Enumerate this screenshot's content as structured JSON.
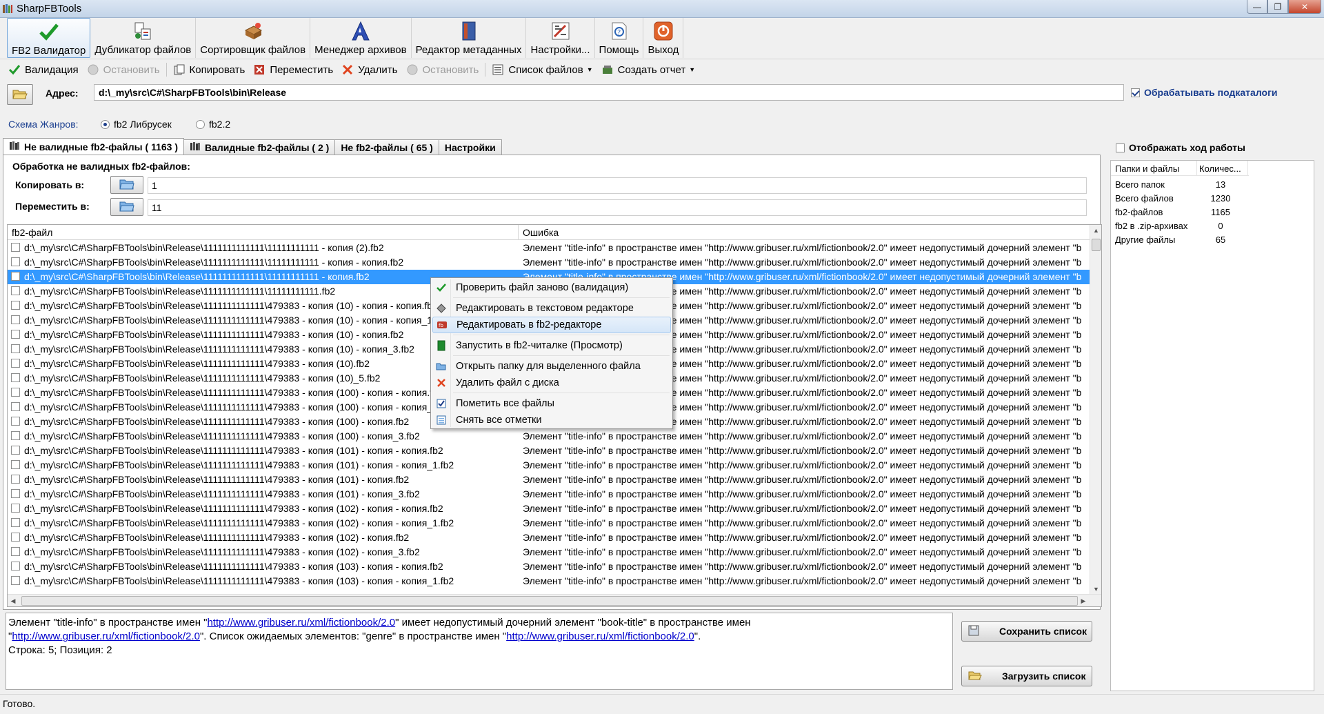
{
  "window": {
    "title": "SharpFBTools",
    "min": "—",
    "max": "❐",
    "close": "✕"
  },
  "big_toolbar": [
    {
      "label": "FB2 Валидатор",
      "icon": "checkmark-icon",
      "active": true
    },
    {
      "label": "Дубликатор файлов",
      "icon": "duplicator-icon"
    },
    {
      "label": "Сортировщик файлов",
      "icon": "sorter-icon"
    },
    {
      "label": "Менеджер архивов",
      "icon": "archive-manager-icon"
    },
    {
      "label": "Редактор метаданных",
      "icon": "metadata-editor-icon"
    },
    {
      "label": "Настройки...",
      "icon": "settings-icon"
    },
    {
      "label": "Помощь",
      "icon": "help-icon"
    },
    {
      "label": "Выход",
      "icon": "exit-icon"
    }
  ],
  "small_toolbar": {
    "validate": "Валидация",
    "stop1": "Остановить",
    "copy": "Копировать",
    "move": "Переместить",
    "delete": "Удалить",
    "stop2": "Остановить",
    "file_list": "Список файлов",
    "report": "Создать отчет"
  },
  "address": {
    "label": "Адрес:",
    "value": "d:\\_my\\src\\C#\\SharpFBTools\\bin\\Release",
    "subdirs_label": "Обрабатывать подкаталоги"
  },
  "genre": {
    "label": "Схема Жанров:",
    "opt1": "fb2 Либрусек",
    "opt2": "fb2.2"
  },
  "tabs": {
    "invalid": "Не валидные fb2-файлы ( 1163 )",
    "valid": "Валидные fb2-файлы ( 2 )",
    "not_fb2": "Не fb2-файлы ( 65 )",
    "settings": "Настройки"
  },
  "processing": {
    "title": "Обработка не валидных fb2-файлов:",
    "copy_label": "Копировать в:",
    "copy_value": "1",
    "move_label": "Переместить в:",
    "move_value": "11"
  },
  "grid": {
    "col1": "fb2-файл",
    "col2": "Ошибка",
    "error_text": "Элемент \"title-info\" в пространстве имен \"http://www.gribuser.ru/xml/fictionbook/2.0\" имеет недопустимый дочерний элемент \"b",
    "rows": [
      "d:\\_my\\src\\C#\\SharpFBTools\\bin\\Release\\1111111111111\\11111111111 - копия (2).fb2",
      "d:\\_my\\src\\C#\\SharpFBTools\\bin\\Release\\1111111111111\\11111111111 - копия - копия.fb2",
      "d:\\_my\\src\\C#\\SharpFBTools\\bin\\Release\\1111111111111\\11111111111 - копия.fb2",
      "d:\\_my\\src\\C#\\SharpFBTools\\bin\\Release\\1111111111111\\11111111111.fb2",
      "d:\\_my\\src\\C#\\SharpFBTools\\bin\\Release\\1111111111111\\479383 - копия (10) - копия - копия.fb2",
      "d:\\_my\\src\\C#\\SharpFBTools\\bin\\Release\\1111111111111\\479383 - копия (10) - копия - копия_1.fb2",
      "d:\\_my\\src\\C#\\SharpFBTools\\bin\\Release\\1111111111111\\479383 - копия (10) - копия.fb2",
      "d:\\_my\\src\\C#\\SharpFBTools\\bin\\Release\\1111111111111\\479383 - копия (10) - копия_3.fb2",
      "d:\\_my\\src\\C#\\SharpFBTools\\bin\\Release\\1111111111111\\479383 - копия (10).fb2",
      "d:\\_my\\src\\C#\\SharpFBTools\\bin\\Release\\1111111111111\\479383 - копия (10)_5.fb2",
      "d:\\_my\\src\\C#\\SharpFBTools\\bin\\Release\\1111111111111\\479383 - копия (100) - копия - копия.fb2",
      "d:\\_my\\src\\C#\\SharpFBTools\\bin\\Release\\1111111111111\\479383 - копия (100) - копия - копия_1.fb2",
      "d:\\_my\\src\\C#\\SharpFBTools\\bin\\Release\\1111111111111\\479383 - копия (100) - копия.fb2",
      "d:\\_my\\src\\C#\\SharpFBTools\\bin\\Release\\1111111111111\\479383 - копия (100) - копия_3.fb2",
      "d:\\_my\\src\\C#\\SharpFBTools\\bin\\Release\\1111111111111\\479383 - копия (101) - копия - копия.fb2",
      "d:\\_my\\src\\C#\\SharpFBTools\\bin\\Release\\1111111111111\\479383 - копия (101) - копия - копия_1.fb2",
      "d:\\_my\\src\\C#\\SharpFBTools\\bin\\Release\\1111111111111\\479383 - копия (101) - копия.fb2",
      "d:\\_my\\src\\C#\\SharpFBTools\\bin\\Release\\1111111111111\\479383 - копия (101) - копия_3.fb2",
      "d:\\_my\\src\\C#\\SharpFBTools\\bin\\Release\\1111111111111\\479383 - копия (102) - копия - копия.fb2",
      "d:\\_my\\src\\C#\\SharpFBTools\\bin\\Release\\1111111111111\\479383 - копия (102) - копия - копия_1.fb2",
      "d:\\_my\\src\\C#\\SharpFBTools\\bin\\Release\\1111111111111\\479383 - копия (102) - копия.fb2",
      "d:\\_my\\src\\C#\\SharpFBTools\\bin\\Release\\1111111111111\\479383 - копия (102) - копия_3.fb2",
      "d:\\_my\\src\\C#\\SharpFBTools\\bin\\Release\\1111111111111\\479383 - копия (103) - копия - копия.fb2",
      "d:\\_my\\src\\C#\\SharpFBTools\\bin\\Release\\1111111111111\\479383 - копия (103) - копия - копия_1.fb2"
    ],
    "selected_index": 2
  },
  "context_menu": [
    {
      "label": "Проверить файл заново (валидация)",
      "icon": "checkmark-icon"
    },
    {
      "label": "Редактировать в текстовом редакторе",
      "icon": "text-editor-icon"
    },
    {
      "label": "Редактировать в fb2-редакторе",
      "icon": "fb2-editor-icon",
      "highlighted": true
    },
    {
      "label": "Запустить в fb2-читалке (Просмотр)",
      "icon": "reader-icon"
    },
    {
      "label": "Открыть папку для выделенного файла",
      "icon": "folder-open-icon"
    },
    {
      "label": "Удалить файл с диска",
      "icon": "delete-icon"
    },
    {
      "label": "Пометить все файлы",
      "icon": "check-all-icon"
    },
    {
      "label": "Снять все отметки",
      "icon": "uncheck-all-icon"
    }
  ],
  "message": {
    "part1": "Элемент \"title-info\" в пространстве имен \"",
    "link": "http://www.gribuser.ru/xml/fictionbook/2.0",
    "part2": "\" имеет недопустимый дочерний элемент \"book-title\" в пространстве имен",
    "part3": "\"",
    "part4": "\". Список ожидаемых элементов: \"genre\" в пространстве имен \"",
    "part5": "\".",
    "line3": "Строка: 5; Позиция: 2"
  },
  "buttons": {
    "save_list": "Сохранить список",
    "load_list": "Загрузить список"
  },
  "right_panel": {
    "progress_label": "Отображать ход работы",
    "col1": "Папки и файлы",
    "col2": "Количес...",
    "rows": [
      {
        "label": "Всего папок",
        "value": "13"
      },
      {
        "label": "Всего файлов",
        "value": "1230"
      },
      {
        "label": "fb2-файлов",
        "value": "1165"
      },
      {
        "label": "fb2 в .zip-архивах",
        "value": "0"
      },
      {
        "label": "Другие файлы",
        "value": "65"
      }
    ]
  },
  "status": {
    "text": "Готово."
  }
}
